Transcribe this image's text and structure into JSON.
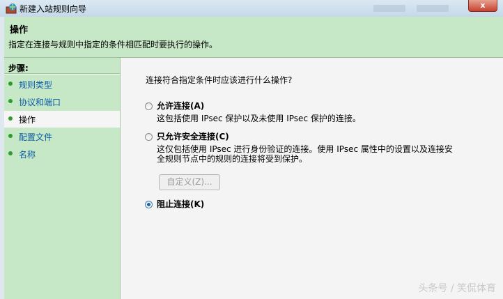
{
  "window": {
    "title": "新建入站规则向导",
    "close_label": "x"
  },
  "header": {
    "title": "操作",
    "description": "指定在连接与规则中指定的条件相匹配时要执行的操作。"
  },
  "sidebar": {
    "steps_label": "步骤:",
    "items": [
      {
        "label": "规则类型"
      },
      {
        "label": "协议和端口"
      },
      {
        "label": "操作"
      },
      {
        "label": "配置文件"
      },
      {
        "label": "名称"
      }
    ],
    "active_index": 2
  },
  "main": {
    "question": "连接符合指定条件时应该进行什么操作?",
    "options": [
      {
        "label": "允许连接(A)",
        "desc": [
          "这包括使用 IPsec 保护以及未使用 IPsec 保护的连接。"
        ],
        "selected": false
      },
      {
        "label": "只允许安全连接(C)",
        "desc": [
          "这仅包括使用 IPsec 进行身份验证的连接。使用 IPsec 属性中的设置以及连接安",
          "全规则节点中的规则的连接将受到保护。"
        ],
        "selected": false
      },
      {
        "label": "阻止连接(K)",
        "desc": [],
        "selected": true
      }
    ],
    "customize_button": "自定义(Z)..."
  },
  "watermark": "头条号 / 笑侃体育"
}
